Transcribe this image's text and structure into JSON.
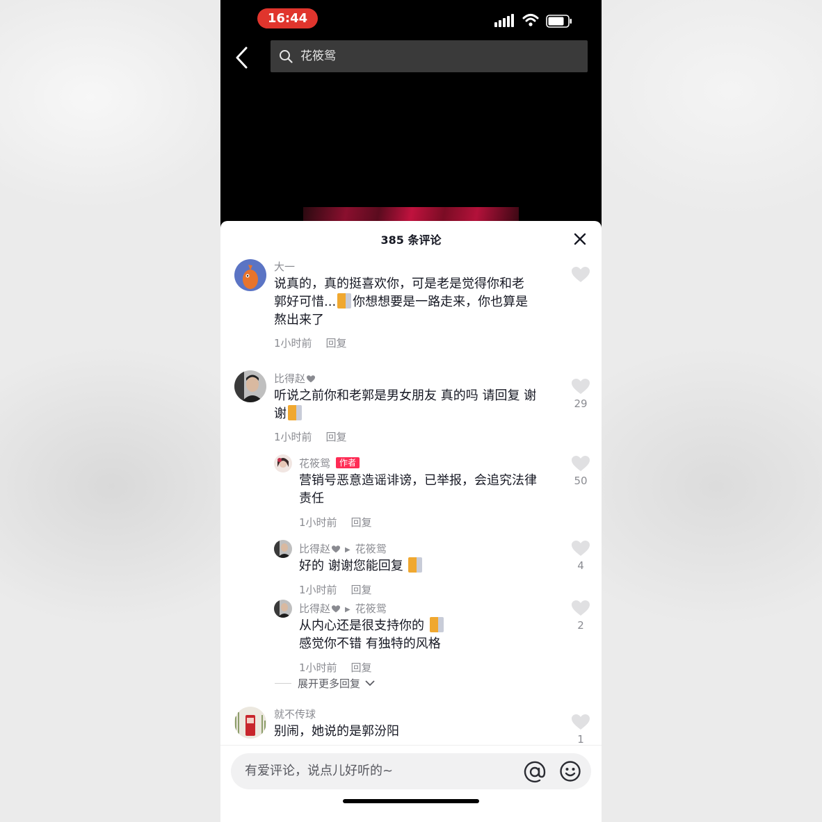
{
  "status_bar": {
    "time": "16:44"
  },
  "search": {
    "query": "花筱鸳"
  },
  "comments_panel": {
    "title": "385 条评论",
    "comments": [
      {
        "user": "大一",
        "text_lines": [
          "说真的，真的挺喜欢你，可是老是觉得你和老",
          "郭好可惜...",
          "你想想要是一路走来，你也算是",
          "熬出来了"
        ],
        "time": "1小时前",
        "reply": "回复",
        "likes": ""
      },
      {
        "user": "比得赵",
        "text_lines": [
          "听说之前你和老郭是男女朋友 真的吗 请回复 谢",
          "谢"
        ],
        "time": "1小时前",
        "reply": "回复",
        "likes": "29",
        "replies": [
          {
            "user": "花筱鸳",
            "badge": "作者",
            "text_lines": [
              "营销号恶意造谣诽谤，已举报，会追究法律",
              "责任"
            ],
            "time": "1小时前",
            "reply": "回复",
            "likes": "50"
          },
          {
            "user": "比得赵",
            "reply_to": "花筱鸳",
            "text_lines": [
              "好的 谢谢您能回复"
            ],
            "time": "1小时前",
            "reply": "回复",
            "likes": "4"
          },
          {
            "user": "比得赵",
            "reply_to": "花筱鸳",
            "text_lines": [
              "从内心还是很支持你的",
              "感觉你不错 有独特的风格"
            ],
            "time": "1小时前",
            "reply": "回复",
            "likes": "2"
          }
        ],
        "expand_label": "展开更多回复"
      },
      {
        "user": "就不传球",
        "text_lines": [
          "别闹，她说的是郭汾阳"
        ],
        "likes": "1"
      }
    ]
  },
  "input": {
    "placeholder": "有爱评论，说点儿好听的~"
  },
  "colors": {
    "accent": "#fe2c55",
    "time_pill": "#e0352d"
  }
}
